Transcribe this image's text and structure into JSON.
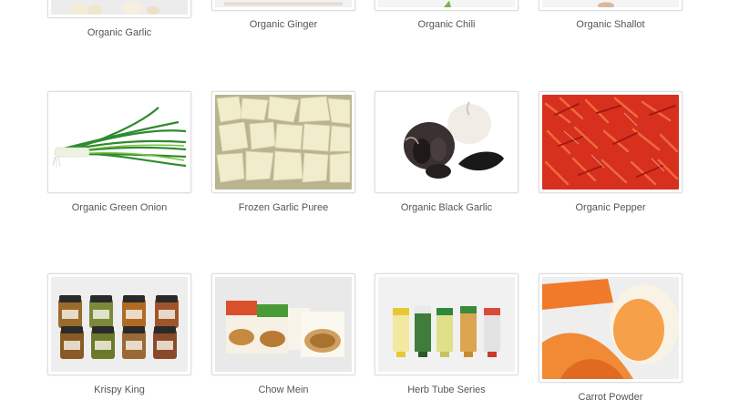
{
  "products": [
    {
      "name": "Organic Garlic",
      "image": "garlic-photo"
    },
    {
      "name": "Organic Ginger",
      "image": "ginger-photo"
    },
    {
      "name": "Organic Chili",
      "image": "chili-photo"
    },
    {
      "name": "Organic Shallot",
      "image": "shallot-photo"
    },
    {
      "name": "Organic Green Onion",
      "image": "green-onion-photo"
    },
    {
      "name": "Frozen Garlic Puree",
      "image": "garlic-puree-photo"
    },
    {
      "name": "Organic Black Garlic",
      "image": "black-garlic-photo"
    },
    {
      "name": "Organic Pepper",
      "image": "pepper-photo"
    },
    {
      "name": "Krispy King",
      "image": "jars-photo"
    },
    {
      "name": "Chow Mein",
      "image": "noodle-boxes-photo"
    },
    {
      "name": "Herb Tube Series",
      "image": "herb-tubes-photo"
    },
    {
      "name": "Carrot Powder",
      "image": "carrot-powder-photo"
    }
  ],
  "colors": {
    "border": "#dedede",
    "label": "#555555"
  }
}
